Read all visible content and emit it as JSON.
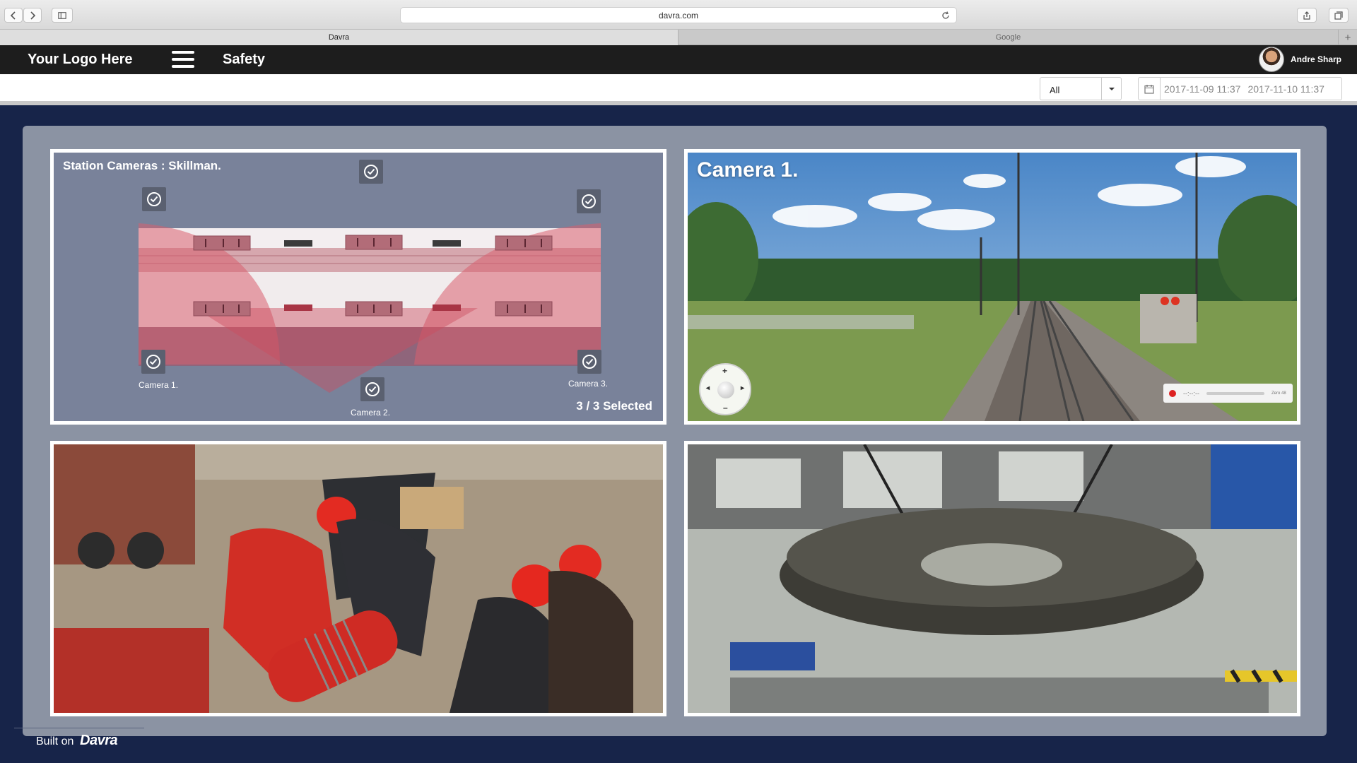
{
  "browser": {
    "url": "davra.com",
    "tabs": [
      {
        "label": "Davra",
        "active": true
      },
      {
        "label": "Google",
        "active": false
      }
    ]
  },
  "header": {
    "logo": "Your Logo Here",
    "page_title": "Safety",
    "user_name": "Andre Sharp"
  },
  "filters": {
    "select_value": "All",
    "date_from": "2017-11-09  11:37",
    "date_to": "2017-11-10  11:37"
  },
  "station_map": {
    "title": "Station Cameras :  Skillman.",
    "cameras": [
      {
        "label": "Camera 1."
      },
      {
        "label": "Camera 2."
      },
      {
        "label": "Camera 3."
      }
    ],
    "selected_text": "3 / 3 Selected"
  },
  "camera_feed": {
    "title": "Camera 1.",
    "player_time": "--:--:--",
    "player_end": "Zero 48"
  },
  "footer": {
    "built_on": "Built on",
    "brand": "Davra"
  },
  "colors": {
    "page_bg": "#172449",
    "panel_bg": "#8b93a3",
    "header_bg": "#1d1d1d",
    "zone_pink": "#e79aa3"
  },
  "icons": [
    "back-icon",
    "forward-icon",
    "sidebar-icon",
    "reload-icon",
    "share-icon",
    "tabs-icon",
    "hamburger-icon",
    "caret-down-icon",
    "calendar-icon",
    "check-circle-icon",
    "ptz-control-icon",
    "record-icon"
  ]
}
